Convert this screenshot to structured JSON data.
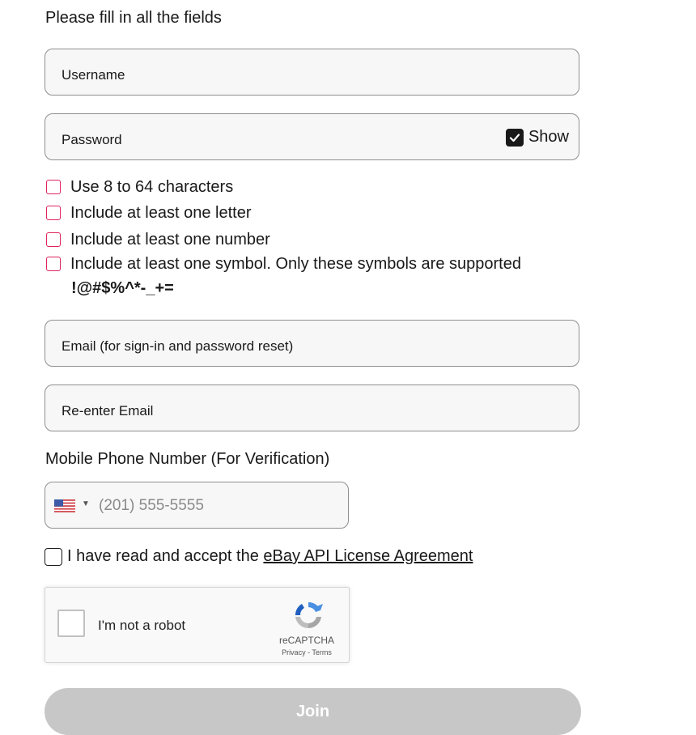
{
  "form": {
    "instruction": "Please fill in all the fields",
    "username_label": "Username",
    "password_label": "Password",
    "show_label": "Show",
    "show_checked": true,
    "password_rules": [
      "Use 8 to 64 characters",
      "Include at least one letter",
      "Include at least one number",
      "Include at least one symbol. Only these symbols are supported"
    ],
    "symbols": "!@#$%^*-_+=",
    "email_label": "Email (for sign-in and password reset)",
    "reenter_email_label": "Re-enter Email",
    "phone_title": "Mobile Phone Number (For Verification)",
    "phone_placeholder": "(201) 555-5555",
    "agree_text": "I have read and accept the ",
    "agree_link": "eBay API License Agreement",
    "join_label": "Join"
  },
  "captcha": {
    "label": "I'm not a robot",
    "brand": "reCAPTCHA",
    "privacy": "Privacy",
    "separator": " - ",
    "terms": "Terms"
  },
  "colors": {
    "rule_box": "#e0245e",
    "join_disabled": "#c7c7c7"
  }
}
